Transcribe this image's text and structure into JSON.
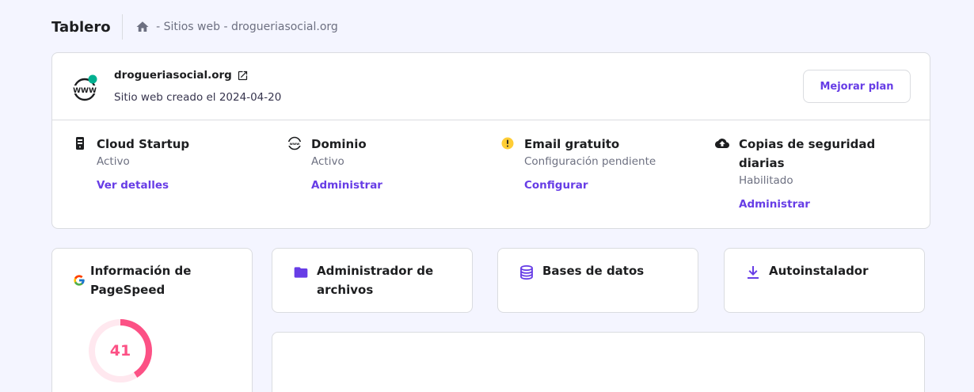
{
  "header": {
    "title": "Tablero",
    "breadcrumb": [
      " - Sitios web",
      " - drogueriasocial.org"
    ]
  },
  "site": {
    "name": "drogueriasocial.org",
    "created": "Sitio web creado el 2024-04-20",
    "upgrade_label": "Mejorar plan",
    "logo_text": "WWW",
    "status_color": "#00b090"
  },
  "features": [
    {
      "icon": "server-icon",
      "title": "Cloud Startup",
      "status": "Activo",
      "link": "Ver detalles"
    },
    {
      "icon": "globe-www-icon",
      "title": "Dominio",
      "status": "Activo",
      "link": "Administrar"
    },
    {
      "icon": "warning-icon",
      "title": "Email gratuito",
      "status": "Configuración pendiente",
      "link": "Configurar"
    },
    {
      "icon": "cloud-upload-icon",
      "title": "Copias de seguridad diarias",
      "status": "Habilitado",
      "link": "Administrar"
    }
  ],
  "pagespeed": {
    "title": "Información de PageSpeed",
    "score": "41",
    "score_fraction": 0.41,
    "color": "#fc5185"
  },
  "tools": [
    {
      "icon": "folder-icon",
      "title": "Administrador de archivos"
    },
    {
      "icon": "database-icon",
      "title": "Bases de datos"
    },
    {
      "icon": "download-icon",
      "title": "Autoinstalador"
    }
  ],
  "colors": {
    "accent": "#673de6",
    "background": "#f4f5ff",
    "warning": "#ffcd35"
  }
}
